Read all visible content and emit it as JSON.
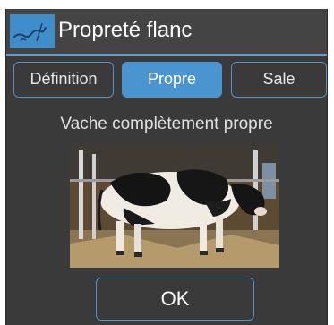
{
  "dialog": {
    "title": "Propreté flanc",
    "logo_icon": "brand-logo-icon",
    "accent_color": "#4a94d0",
    "background_color": "#3a3a3a"
  },
  "tabs": [
    {
      "label": "Définition",
      "active": false
    },
    {
      "label": "Propre",
      "active": true
    },
    {
      "label": "Sale",
      "active": false
    }
  ],
  "content": {
    "caption": "Vache complètement propre",
    "image": "holstein-cow-in-barn-photo"
  },
  "footer": {
    "ok_label": "OK"
  }
}
